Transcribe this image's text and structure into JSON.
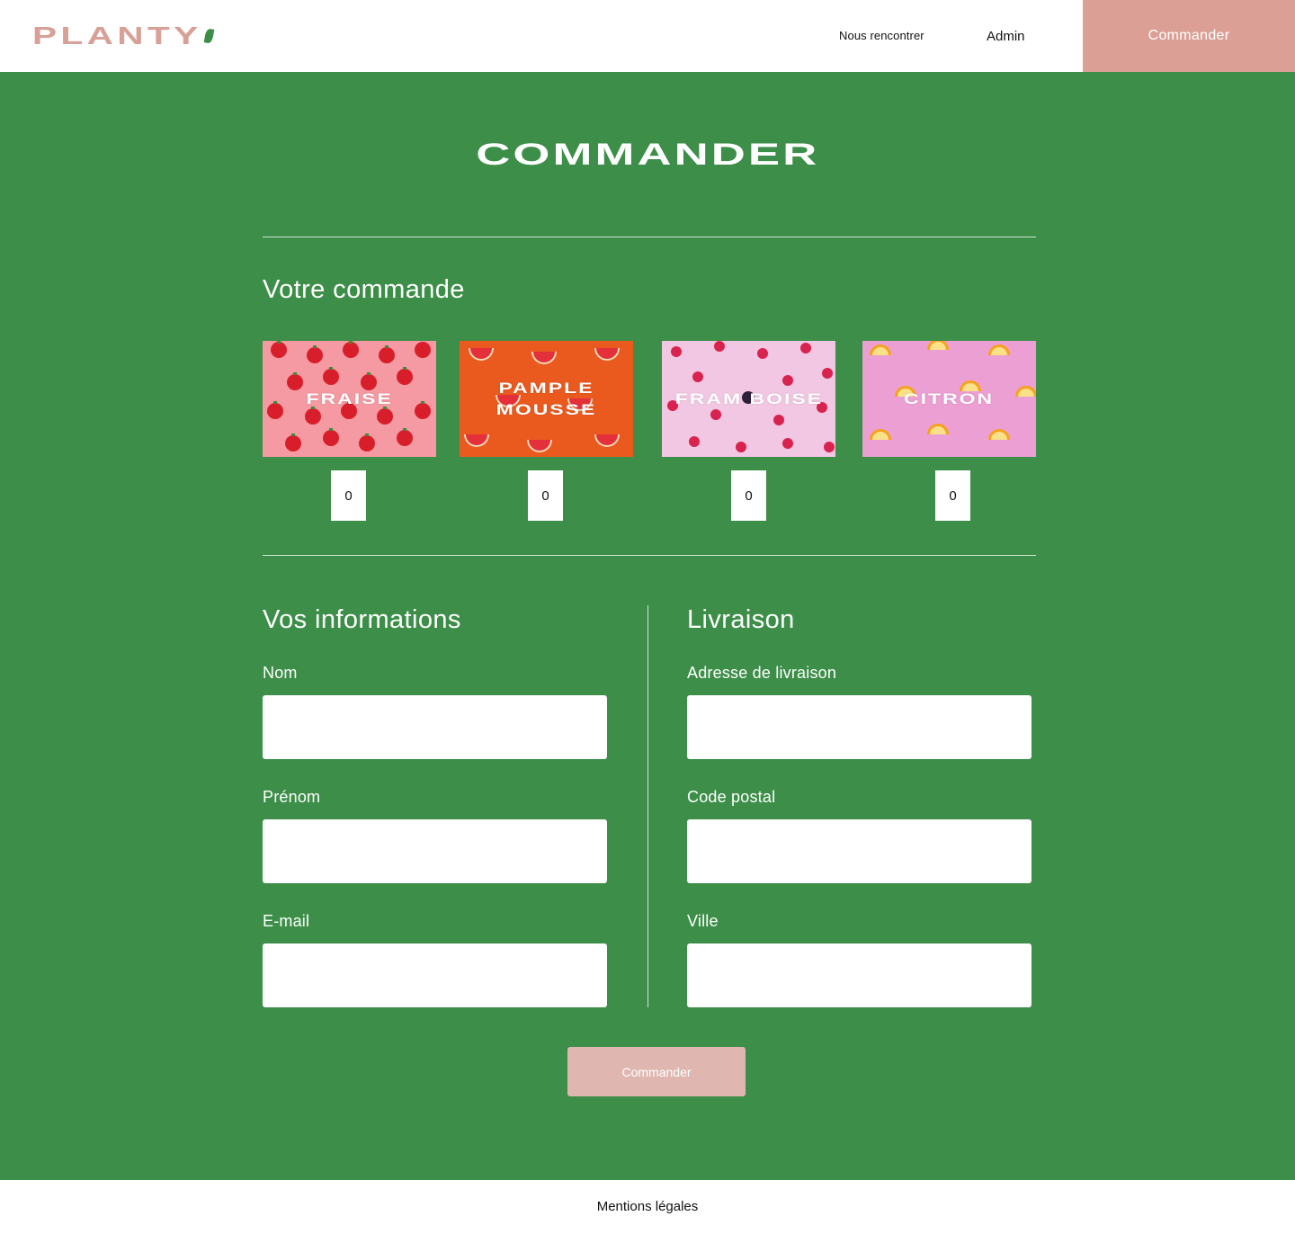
{
  "header": {
    "logo_text": "PLANTY",
    "nav": [
      {
        "label": "Nous rencontrer"
      },
      {
        "label": "Admin"
      }
    ],
    "cta_label": "Commander"
  },
  "main": {
    "title": "COMMANDER",
    "order": {
      "title": "Votre commande",
      "products": [
        {
          "name": "FRAISE",
          "quantity": "0"
        },
        {
          "name": "PAMPLE MOUSSE",
          "quantity": "0"
        },
        {
          "name": "FRAM BOISE",
          "quantity": "0"
        },
        {
          "name": "CITRON",
          "quantity": "0"
        }
      ]
    },
    "info": {
      "title": "Vos informations",
      "fields": [
        {
          "label": "Nom",
          "value": ""
        },
        {
          "label": "Prénom",
          "value": ""
        },
        {
          "label": "E-mail",
          "value": ""
        }
      ]
    },
    "shipping": {
      "title": "Livraison",
      "fields": [
        {
          "label": "Adresse de livraison",
          "value": ""
        },
        {
          "label": "Code postal",
          "value": ""
        },
        {
          "label": "Ville",
          "value": ""
        }
      ]
    },
    "submit_label": "Commander"
  },
  "footer": {
    "link": "Mentions légales"
  },
  "colors": {
    "brand_green": "#3c8e48",
    "brand_pink": "#db9f96",
    "submit_disabled": "#dfb7b0"
  },
  "icons": [
    "leaf-icon"
  ]
}
